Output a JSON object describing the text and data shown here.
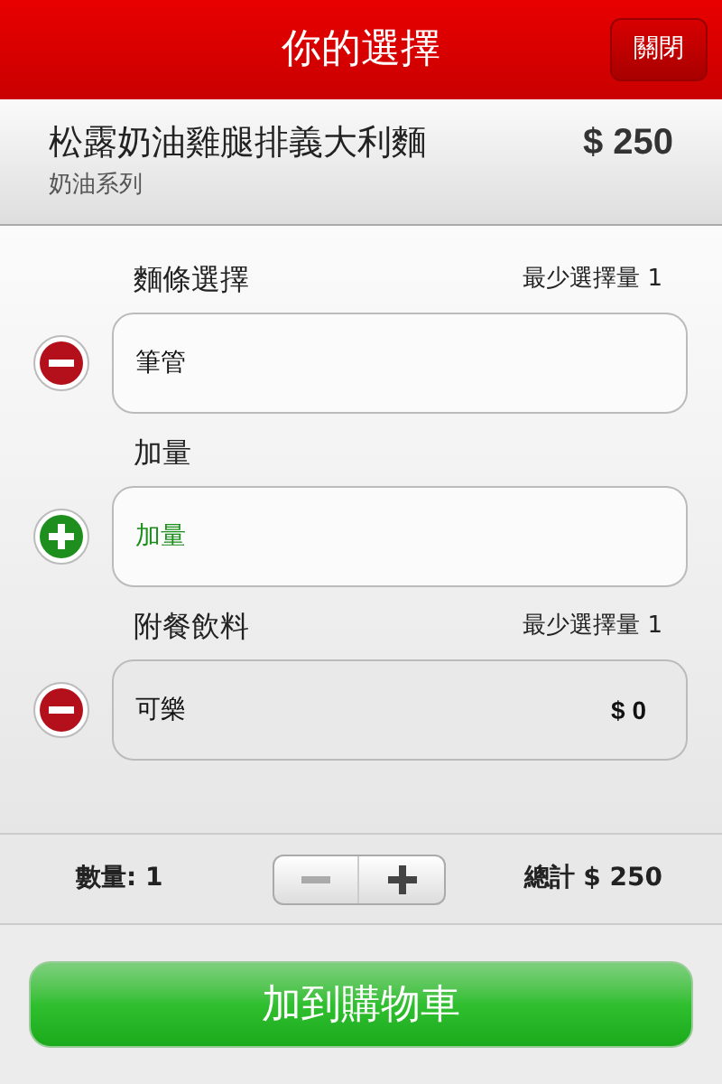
{
  "header": {
    "title": "你的選擇",
    "close_button": "關閉"
  },
  "item": {
    "name": "松露奶油雞腿排義大利麵",
    "price": "$ 250",
    "category": "奶油系列"
  },
  "groups": [
    {
      "title": "麵條選擇",
      "note": "最少選擇量 1",
      "option": {
        "kind": "remove",
        "label": "筆管",
        "highlighted": false
      }
    },
    {
      "title": "加量",
      "option": {
        "kind": "add",
        "label": "加量",
        "highlighted": false
      }
    },
    {
      "title": "附餐飲料",
      "note": "最少選擇量 1",
      "option": {
        "kind": "remove",
        "label": "可樂",
        "price": "$ 0",
        "highlighted": true
      }
    }
  ],
  "footer": {
    "quantity": "數量: 1",
    "decrement_disabled": true,
    "total": "總計 $ 250"
  },
  "add_to_cart": "加到購物車"
}
